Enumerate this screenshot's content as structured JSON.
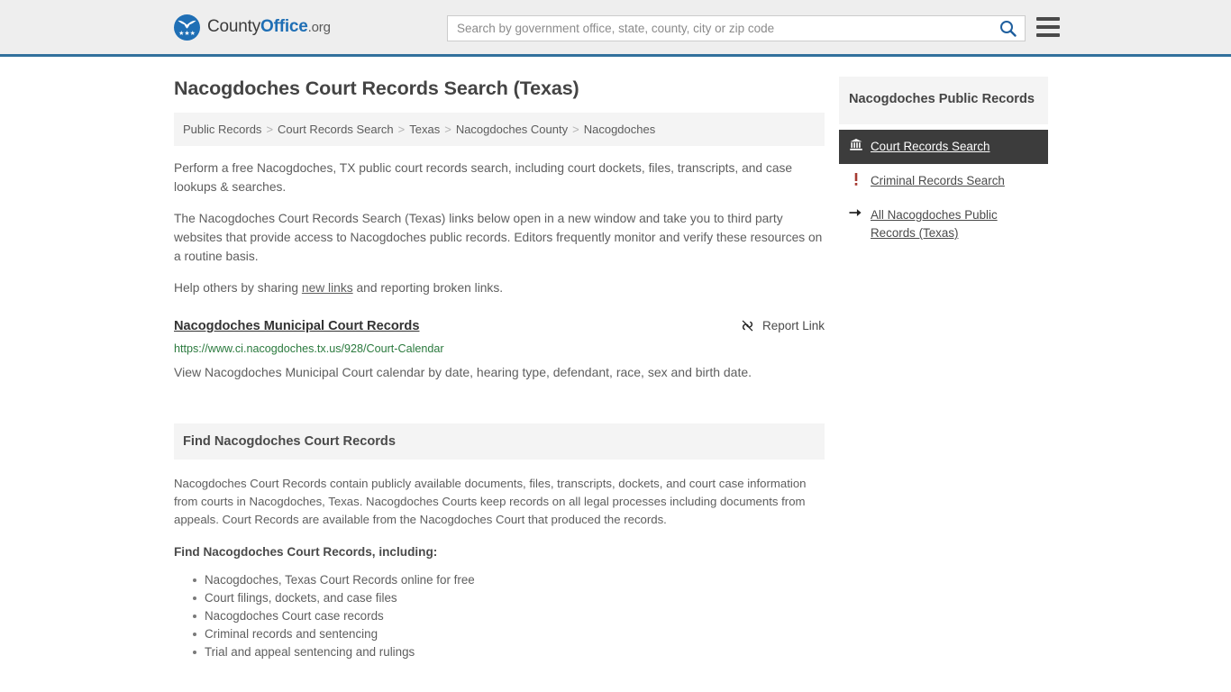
{
  "header": {
    "brand": {
      "part1": "County",
      "part2": "Office",
      "part3": ".org",
      "logo_icon": "countyoffice-eagle-logo"
    },
    "search": {
      "placeholder": "Search by government office, state, county, city or zip code",
      "value": "",
      "search_icon": "search-icon"
    },
    "menu_icon": "hamburger-menu-icon",
    "accent_color": "#31709c",
    "background": "#eeeeee"
  },
  "main": {
    "title": "Nacogdoches Court Records Search (Texas)",
    "breadcrumb": [
      "Public Records",
      "Court Records Search",
      "Texas",
      "Nacogdoches County",
      "Nacogdoches"
    ],
    "breadcrumb_separator": ">",
    "paragraphs": {
      "p1": "Perform a free Nacogdoches, TX public court records search, including court dockets, files, transcripts, and case lookups & searches.",
      "p2": "The Nacogdoches Court Records Search (Texas) links below open in a new window and take you to third party websites that provide access to Nacogdoches public records. Editors frequently monitor and verify these resources on a routine basis.",
      "p3_before": "Help others by sharing ",
      "p3_link": "new links",
      "p3_after": " and reporting broken links."
    },
    "result": {
      "title": "Nacogdoches Municipal Court Records",
      "url": "https://www.ci.nacogdoches.tx.us/928/Court-Calendar",
      "url_color": "#2b7a3e",
      "description": "View Nacogdoches Municipal Court calendar by date, hearing type, defendant, race, sex and birth date.",
      "report_label": "Report Link",
      "report_icon": "broken-link-icon"
    },
    "section": {
      "heading": "Find Nacogdoches Court Records",
      "body": "Nacogdoches Court Records contain publicly available documents, files, transcripts, dockets, and court case information from courts in Nacogdoches, Texas. Nacogdoches Courts keep records on all legal processes including documents from appeals. Court Records are available from the Nacogdoches Court that produced the records.",
      "list_intro": "Find Nacogdoches Court Records, including:",
      "bullets": [
        "Nacogdoches, Texas Court Records online for free",
        "Court filings, dockets, and case files",
        "Nacogdoches Court case records",
        "Criminal records and sentencing",
        "Trial and appeal sentencing and rulings"
      ]
    }
  },
  "sidebar": {
    "heading": "Nacogdoches Public Records",
    "items": [
      {
        "label": "Court Records Search",
        "icon": "bank-courthouse-icon",
        "active": true
      },
      {
        "label": "Criminal Records Search",
        "icon": "exclamation-mark-icon",
        "active": false
      },
      {
        "label": "All Nacogdoches Public Records (Texas)",
        "icon": "arrow-right-icon",
        "active": false
      }
    ]
  }
}
